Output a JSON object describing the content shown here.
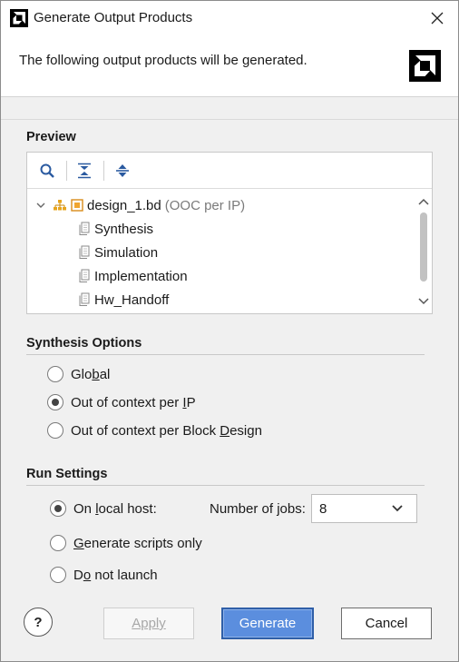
{
  "window": {
    "title": "Generate Output Products"
  },
  "header": {
    "message": "The following output products will be generated."
  },
  "preview": {
    "title": "Preview",
    "tree": {
      "root": {
        "name": "design_1.bd",
        "qualifier": "(OOC per IP)"
      },
      "children": [
        "Synthesis",
        "Simulation",
        "Implementation",
        "Hw_Handoff"
      ]
    }
  },
  "synthesis_options": {
    "title": "Synthesis Options",
    "options": [
      {
        "before": "Glo",
        "accel": "b",
        "after": "al",
        "selected": false
      },
      {
        "before": "Out of context per ",
        "accel": "I",
        "after": "P",
        "selected": true
      },
      {
        "before": "Out of context per Block ",
        "accel": "D",
        "after": "esign",
        "selected": false
      }
    ]
  },
  "run_settings": {
    "title": "Run Settings",
    "local_host": {
      "before": "On ",
      "accel": "l",
      "after": "ocal host:",
      "selected": true
    },
    "scripts_only": {
      "before": "",
      "accel": "G",
      "after": "enerate scripts only",
      "selected": false
    },
    "do_not_launch": {
      "before": "D",
      "accel": "o",
      "after": " not launch",
      "selected": false
    },
    "jobs": {
      "label_before": "Number of ",
      "label_accel": "j",
      "label_after": "obs:",
      "value": "8"
    }
  },
  "buttons": {
    "help": "?",
    "apply": "Apply",
    "generate": "Generate",
    "cancel": "Cancel"
  }
}
